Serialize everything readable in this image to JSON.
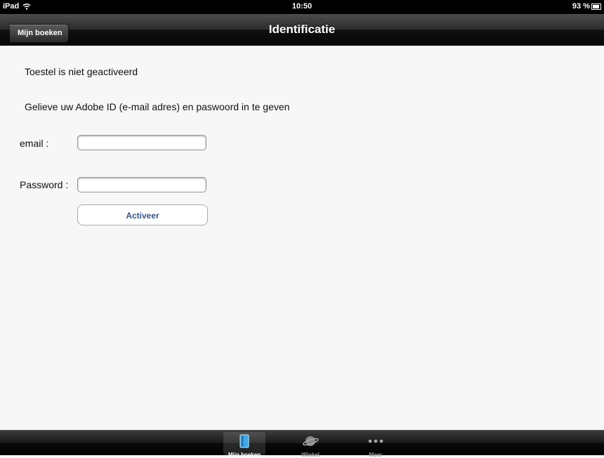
{
  "status_bar": {
    "carrier": "iPad",
    "time": "10:50",
    "battery": "93 %"
  },
  "nav": {
    "back_label": "Mijn boeken",
    "title": "Identificatie"
  },
  "content": {
    "message_not_activated": "Toestel is niet geactiveerd",
    "message_instructions": "Gelieve uw Adobe ID (e-mail adres) en paswoord in te geven",
    "email_label": "email :",
    "email_value": "",
    "password_label": "Password :",
    "password_value": "",
    "activate_label": "Activeer"
  },
  "tab_bar": {
    "tabs": [
      {
        "label": "Mijn boeken",
        "icon": "book-icon",
        "selected": true
      },
      {
        "label": "Winkel",
        "icon": "planet-icon",
        "selected": false
      },
      {
        "label": "Meer",
        "icon": "more-dots-icon",
        "selected": false
      }
    ]
  },
  "colors": {
    "button_text": "#355487",
    "background": "#f7f7f7"
  }
}
